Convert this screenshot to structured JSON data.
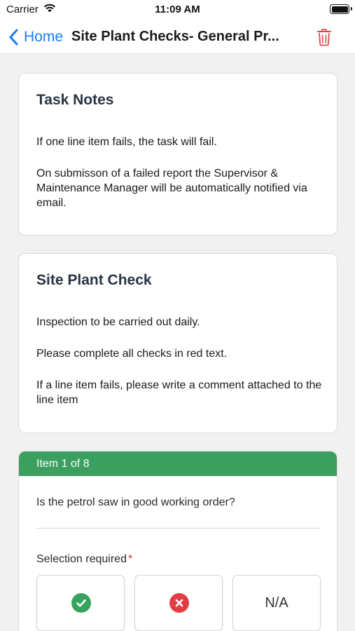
{
  "status_bar": {
    "carrier": "Carrier",
    "time": "11:09 AM"
  },
  "nav": {
    "back_label": "Home",
    "title": "Site Plant Checks- General Pr..."
  },
  "task_notes": {
    "heading": "Task Notes",
    "paragraphs": [
      "If one line item fails, the task will fail.",
      "On submisson of a failed report the Supervisor & Maintenance Manager will be automatically notified via email."
    ]
  },
  "site_plant_check": {
    "heading": "Site Plant Check",
    "paragraphs": [
      "Inspection to be carried out daily.",
      "Please complete all checks in red text.",
      "If a line item fails, please write a comment attached to the line item"
    ]
  },
  "item": {
    "header": "Item 1 of 8",
    "question": "Is the petrol saw in good working order?",
    "selection_label": "Selection required",
    "required_marker": "*",
    "options": {
      "pass_icon": "check-icon",
      "fail_icon": "x-icon",
      "na_label": "N/A"
    }
  },
  "colors": {
    "accent_blue": "#1a7cf6",
    "header_green": "#3b9f5f",
    "pass_green": "#37a35f",
    "fail_red": "#e33d44",
    "delete_red": "#e04848"
  }
}
